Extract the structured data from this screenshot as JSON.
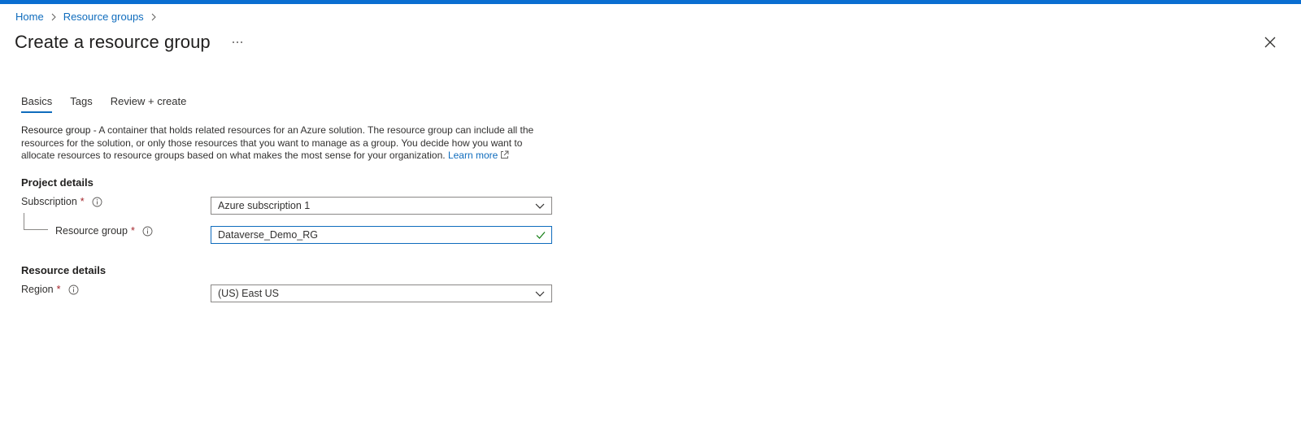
{
  "breadcrumb": {
    "items": [
      "Home",
      "Resource groups"
    ]
  },
  "page": {
    "title": "Create a resource group",
    "more_glyph": "···"
  },
  "tabs": [
    {
      "label": "Basics",
      "active": true
    },
    {
      "label": "Tags",
      "active": false
    },
    {
      "label": "Review + create",
      "active": false
    }
  ],
  "description": {
    "lead": "Resource group",
    "text": " - A container that holds related resources for an Azure solution. The resource group can include all the resources for the solution, or only those resources that you want to manage as a group. You decide how you want to allocate resources to resource groups based on what makes the most sense for your organization. ",
    "learn_more": "Learn more"
  },
  "project_details": {
    "heading": "Project details",
    "subscription": {
      "label": "Subscription",
      "required": "*",
      "value": "Azure subscription 1"
    },
    "resource_group": {
      "label": "Resource group",
      "required": "*",
      "value": "Dataverse_Demo_RG"
    }
  },
  "resource_details": {
    "heading": "Resource details",
    "region": {
      "label": "Region",
      "required": "*",
      "value": "(US) East US"
    }
  },
  "colors": {
    "accent": "#0f6cbd",
    "topbar": "#0a6ed1",
    "required": "#a4262c",
    "valid": "#107c10"
  },
  "icons": {
    "breadcrumb_separator": "chevron-right-icon",
    "close": "close-icon",
    "info": "info-icon",
    "dropdown": "chevron-down-icon",
    "valid": "checkmark-icon",
    "external": "external-link-icon"
  }
}
